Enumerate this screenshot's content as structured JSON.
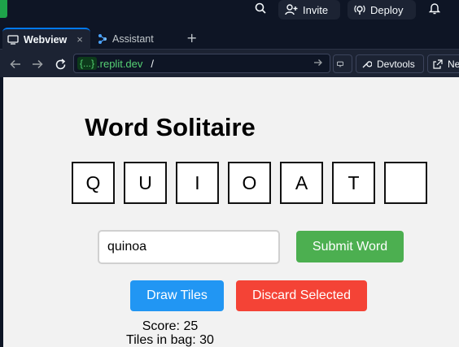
{
  "topbar": {
    "invite_label": "Invite",
    "deploy_label": "Deploy"
  },
  "tabs": [
    {
      "label": "Webview",
      "close": "×"
    },
    {
      "label": "Assistant"
    }
  ],
  "new_tab": "+",
  "address": {
    "host_badge": "{...}",
    "host_rest": ".replit.dev",
    "path": "/",
    "devtools_label": "Devtools",
    "new_tab_label": "Ne"
  },
  "game": {
    "title": "Word Solitaire",
    "tiles": [
      "Q",
      "U",
      "I",
      "O",
      "A",
      "T",
      ""
    ],
    "word_input_value": "quinoa",
    "submit_label": "Submit Word",
    "draw_label": "Draw Tiles",
    "discard_label": "Discard Selected",
    "score_text": "Score: 25",
    "bag_text": "Tiles in bag: 30"
  },
  "colors": {
    "accent_blue": "#2196f3",
    "submit_green": "#4caf50",
    "discard_red": "#f44336",
    "url_green": "#56d174"
  }
}
